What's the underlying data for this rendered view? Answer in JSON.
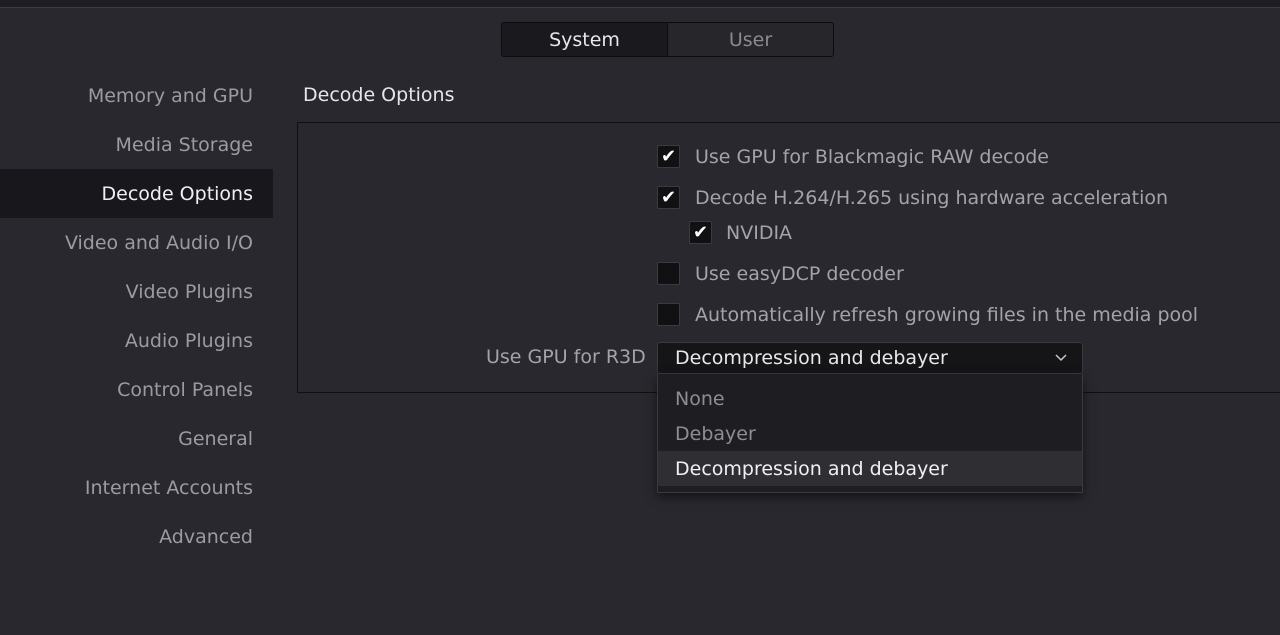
{
  "tabs": [
    {
      "label": "System",
      "active": true
    },
    {
      "label": "User",
      "active": false
    }
  ],
  "sidebar": {
    "items": [
      {
        "label": "Memory and GPU"
      },
      {
        "label": "Media Storage"
      },
      {
        "label": "Decode Options",
        "active": true
      },
      {
        "label": "Video and Audio I/O"
      },
      {
        "label": "Video Plugins"
      },
      {
        "label": "Audio Plugins"
      },
      {
        "label": "Control Panels"
      },
      {
        "label": "General"
      },
      {
        "label": "Internet Accounts"
      },
      {
        "label": "Advanced"
      }
    ]
  },
  "main": {
    "section_title": "Decode Options",
    "options": [
      {
        "label": "Use GPU for Blackmagic RAW decode",
        "checked": true
      },
      {
        "label": "Decode H.264/H.265 using hardware acceleration",
        "checked": true
      },
      {
        "label": "NVIDIA",
        "checked": true
      },
      {
        "label": "Use easyDCP decoder",
        "checked": false
      },
      {
        "label": "Automatically refresh growing files in the media pool",
        "checked": false
      }
    ],
    "check_glyph": "✔",
    "r3d": {
      "label": "Use GPU for R3D",
      "value": "Decompression and debayer",
      "options": [
        "None",
        "Debayer",
        "Decompression and debayer"
      ]
    }
  },
  "icons": {
    "dropdown": "chevron-down-icon",
    "check": "checkmark-icon"
  }
}
